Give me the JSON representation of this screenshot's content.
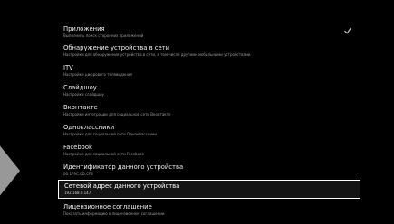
{
  "settings": {
    "items": [
      {
        "title": "Приложения",
        "subtitle": "Выполнить поиск сторонних приложений",
        "checked": true,
        "selected": false
      },
      {
        "title": "Обнаружение устройства в сети",
        "subtitle": "Настройки для обнаружения устройства в сети, в том числе другими мобильными устройствами",
        "checked": false,
        "selected": false
      },
      {
        "title": "ITV",
        "subtitle": "Настройки цифрового телевидения",
        "checked": false,
        "selected": false
      },
      {
        "title": "Слайдшоу",
        "subtitle": "Настройки слайдшоу",
        "checked": false,
        "selected": false
      },
      {
        "title": "Вконтакте",
        "subtitle": "Настройки интеграции для социальной сети Вконтакте",
        "checked": false,
        "selected": false
      },
      {
        "title": "Одноклассники",
        "subtitle": "Настройки для социальной сети Одноклассники",
        "checked": false,
        "selected": false
      },
      {
        "title": "Facebook",
        "subtitle": "Настройки для социальной сети Facebook",
        "checked": false,
        "selected": false
      },
      {
        "title": "Идентификатор данного устройства",
        "subtitle": "00:1F9C:CD:CF3",
        "checked": false,
        "selected": false
      },
      {
        "title": "Сетевой адрес данного устройства",
        "subtitle": "192.168.0.147",
        "checked": false,
        "selected": true
      },
      {
        "title": "Лицензионное соглашение",
        "subtitle": "Показать информацию о лицензионном соглашении",
        "checked": false,
        "selected": false
      }
    ]
  },
  "colors": {
    "background": "#000000",
    "text": "#f0f0f0",
    "subtext": "#9a9a9a",
    "selection_border": "#ffffff",
    "arrow": "#b3b3b3"
  },
  "icons": {
    "check": "check-icon",
    "left_arrow": "left-arrow-icon"
  }
}
